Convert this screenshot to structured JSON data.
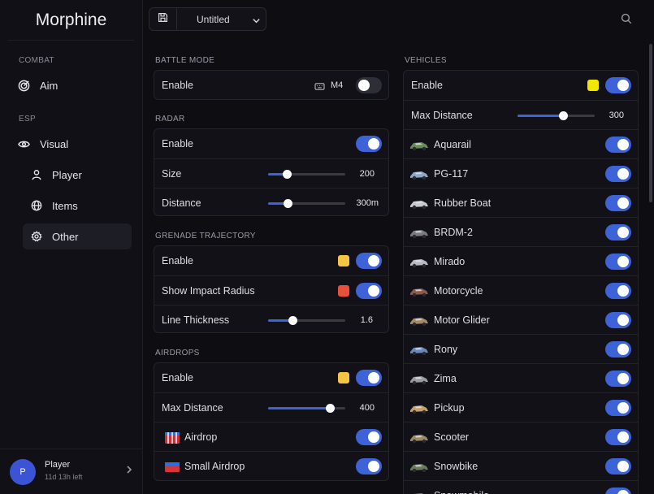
{
  "app": {
    "name": "Morphine"
  },
  "sidebar": {
    "combat_label": "COMBAT",
    "esp_label": "ESP",
    "items": [
      {
        "label": "Aim",
        "icon": "target-icon"
      },
      {
        "label": "Visual",
        "icon": "eye-icon"
      },
      {
        "label": "Player",
        "icon": "person-icon"
      },
      {
        "label": "Items",
        "icon": "globe-icon"
      },
      {
        "label": "Other",
        "icon": "gear-icon",
        "active": true
      }
    ],
    "user": {
      "avatar_letter": "P",
      "name": "Player",
      "subscription": "11d 13h left"
    }
  },
  "topbar": {
    "config_name": "Untitled"
  },
  "battle_mode": {
    "title": "BATTLE MODE",
    "enable_label": "Enable",
    "key_label": "M4",
    "enabled": false
  },
  "radar": {
    "title": "RADAR",
    "enable_label": "Enable",
    "size_label": "Size",
    "size_value": "200",
    "size_fraction": 0.24,
    "distance_label": "Distance",
    "distance_value": "300m",
    "distance_fraction": 0.25
  },
  "grenade": {
    "title": "GRENADE TRAJECTORY",
    "enable_label": "Enable",
    "enable_color": "#f5c542",
    "impact_label": "Show Impact Radius",
    "impact_color": "#e8503a",
    "thickness_label": "Line Thickness",
    "thickness_value": "1.6",
    "thickness_fraction": 0.32
  },
  "airdrops": {
    "title": "AIRDROPS",
    "enable_label": "Enable",
    "enable_color": "#f5c542",
    "max_distance_label": "Max Distance",
    "max_distance_value": "400",
    "max_distance_fraction": 0.8,
    "items": [
      {
        "label": "Airdrop",
        "icon": "airdrop-crate-icon"
      },
      {
        "label": "Small Airdrop",
        "icon": "small-airdrop-crate-icon"
      }
    ]
  },
  "vehicles": {
    "title": "VEHICLES",
    "enable_label": "Enable",
    "enable_color": "#f0e800",
    "max_distance_label": "Max Distance",
    "max_distance_value": "300",
    "max_distance_fraction": 0.59,
    "items": [
      {
        "label": "Aquarail",
        "icon": "aquarail-icon"
      },
      {
        "label": "PG-117",
        "icon": "boat-icon"
      },
      {
        "label": "Rubber Boat",
        "icon": "rubber-boat-icon"
      },
      {
        "label": "BRDM-2",
        "icon": "armored-car-icon"
      },
      {
        "label": "Mirado",
        "icon": "car-icon"
      },
      {
        "label": "Motorcycle",
        "icon": "motorcycle-icon"
      },
      {
        "label": "Motor Glider",
        "icon": "glider-icon"
      },
      {
        "label": "Rony",
        "icon": "truck-icon"
      },
      {
        "label": "Zima",
        "icon": "jeep-icon"
      },
      {
        "label": "Pickup",
        "icon": "pickup-icon"
      },
      {
        "label": "Scooter",
        "icon": "scooter-icon"
      },
      {
        "label": "Snowbike",
        "icon": "snowbike-icon"
      },
      {
        "label": "Snowmobile",
        "icon": "snowmobile-icon"
      }
    ]
  }
}
